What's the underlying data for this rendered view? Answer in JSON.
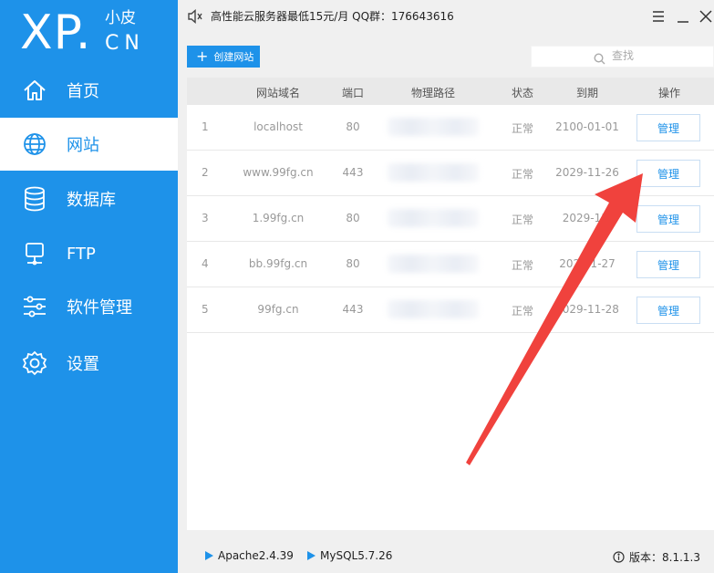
{
  "brand": {
    "logo_main": "XP.",
    "logo_cn": "小皮",
    "logo_sub": "CN",
    "accent": "#1e92e9"
  },
  "sidebar": {
    "items": [
      {
        "label": "首页",
        "icon": "home-icon",
        "active": false
      },
      {
        "label": "网站",
        "icon": "globe-icon",
        "active": true
      },
      {
        "label": "数据库",
        "icon": "database-icon",
        "active": false
      },
      {
        "label": "FTP",
        "icon": "ftp-server-icon",
        "active": false
      },
      {
        "label": "软件管理",
        "icon": "sliders-icon",
        "active": false
      },
      {
        "label": "设置",
        "icon": "gear-icon",
        "active": false
      }
    ]
  },
  "topbar": {
    "notice": "高性能云服务器最低15元/月  QQ群：176643616"
  },
  "toolbar": {
    "create_label": "创建网站",
    "search_placeholder": "查找"
  },
  "table": {
    "columns": [
      "网站域名",
      "端口",
      "物理路径",
      "状态",
      "到期",
      "操作"
    ],
    "rows": [
      {
        "index": "1",
        "domain": "localhost",
        "port": "80",
        "status": "正常",
        "expiry": "2100-01-01",
        "action": "管理"
      },
      {
        "index": "2",
        "domain": "www.99fg.cn",
        "port": "443",
        "status": "正常",
        "expiry": "2029-11-26",
        "action": "管理"
      },
      {
        "index": "3",
        "domain": "1.99fg.cn",
        "port": "80",
        "status": "正常",
        "expiry": "2029-11-",
        "action": "管理"
      },
      {
        "index": "4",
        "domain": "bb.99fg.cn",
        "port": "80",
        "status": "正常",
        "expiry": "2029 1-27",
        "action": "管理"
      },
      {
        "index": "5",
        "domain": "99fg.cn",
        "port": "443",
        "status": "正常",
        "expiry": "2029-11-28",
        "action": "管理"
      }
    ]
  },
  "bottombar": {
    "apache": "Apache2.4.39",
    "mysql": "MySQL5.7.26",
    "version": "版本：8.1.1.3"
  },
  "annotation": {
    "arrow_color": "#f0423d"
  }
}
